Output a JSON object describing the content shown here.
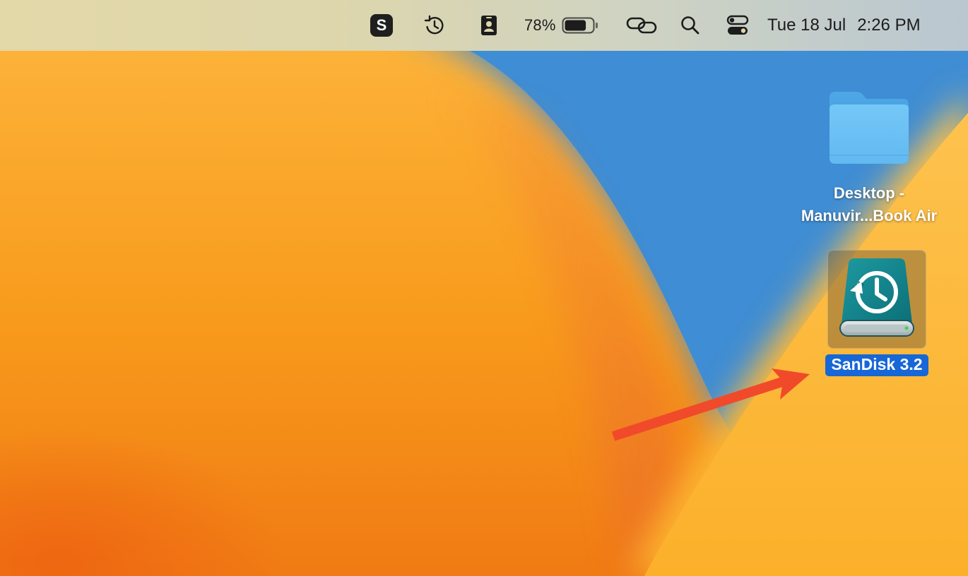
{
  "menubar": {
    "s_app_letter": "S",
    "battery_percent": "78%",
    "battery_level": 0.78,
    "date": "Tue 18 Jul",
    "time": "2:26 PM",
    "icons": [
      "s-app-icon",
      "time-machine-icon",
      "contact-card-icon",
      "battery-icon",
      "link-icon",
      "search-icon",
      "control-center-icon"
    ]
  },
  "desktop": {
    "folder": {
      "label_line1": "Desktop -",
      "label_line2": "Manuvir...Book Air",
      "icon": "folder-icon",
      "color": "#6ec3f5"
    },
    "drive": {
      "label": "SanDisk 3.2",
      "icon": "time-machine-drive-icon",
      "selected": true,
      "color": "#17888f"
    },
    "annotation": {
      "icon": "arrow-icon",
      "color": "#f04a2b"
    }
  },
  "colors": {
    "selection": "#1767d6",
    "wallpaper_orange": "#f7a21e",
    "wallpaper_blue": "#3f8dd4"
  }
}
